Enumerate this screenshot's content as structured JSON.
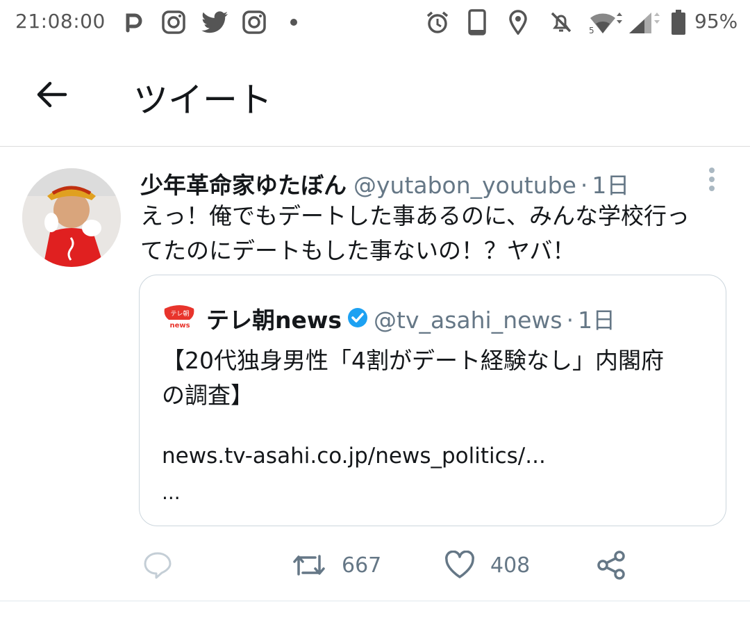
{
  "status_bar": {
    "time": "21:08:00",
    "left_icons": [
      "p-icon",
      "instagram-icon",
      "twitter-icon",
      "instagram-icon",
      "dot-icon"
    ],
    "right_icons": [
      "alarm-icon",
      "phone-icon",
      "location-icon",
      "mute-icon",
      "wifi-icon",
      "signal-icon",
      "battery-icon"
    ],
    "battery": "95%"
  },
  "header": {
    "title": "ツイート"
  },
  "tweet": {
    "display_name": "少年革命家ゆたぼん",
    "handle": "@yutabon_youtube",
    "separator": "·",
    "time": "1日",
    "text_line1": "えっ！俺でもデートした事あるのに、みんな学校行っ",
    "text_line2": "てたのにデートもした事ないの！？ヤバ！",
    "quote": {
      "logo_text_top": "テレ朝",
      "logo_text_bottom": "news",
      "display_name": "テレ朝news",
      "handle": "@tv_asahi_news",
      "separator": "·",
      "time": "1日",
      "text_line1": "【20代独身男性「4割がデート経験なし」内閣府",
      "text_line2": "の調査】",
      "link": "news.tv-asahi.co.jp/news_politics/...",
      "ellipsis": "..."
    },
    "actions": {
      "retweets": "667",
      "likes": "408"
    }
  },
  "colors": {
    "accent": "#1da1f2",
    "muted": "#657786",
    "text": "#14171a",
    "border": "#ccd6dd"
  }
}
